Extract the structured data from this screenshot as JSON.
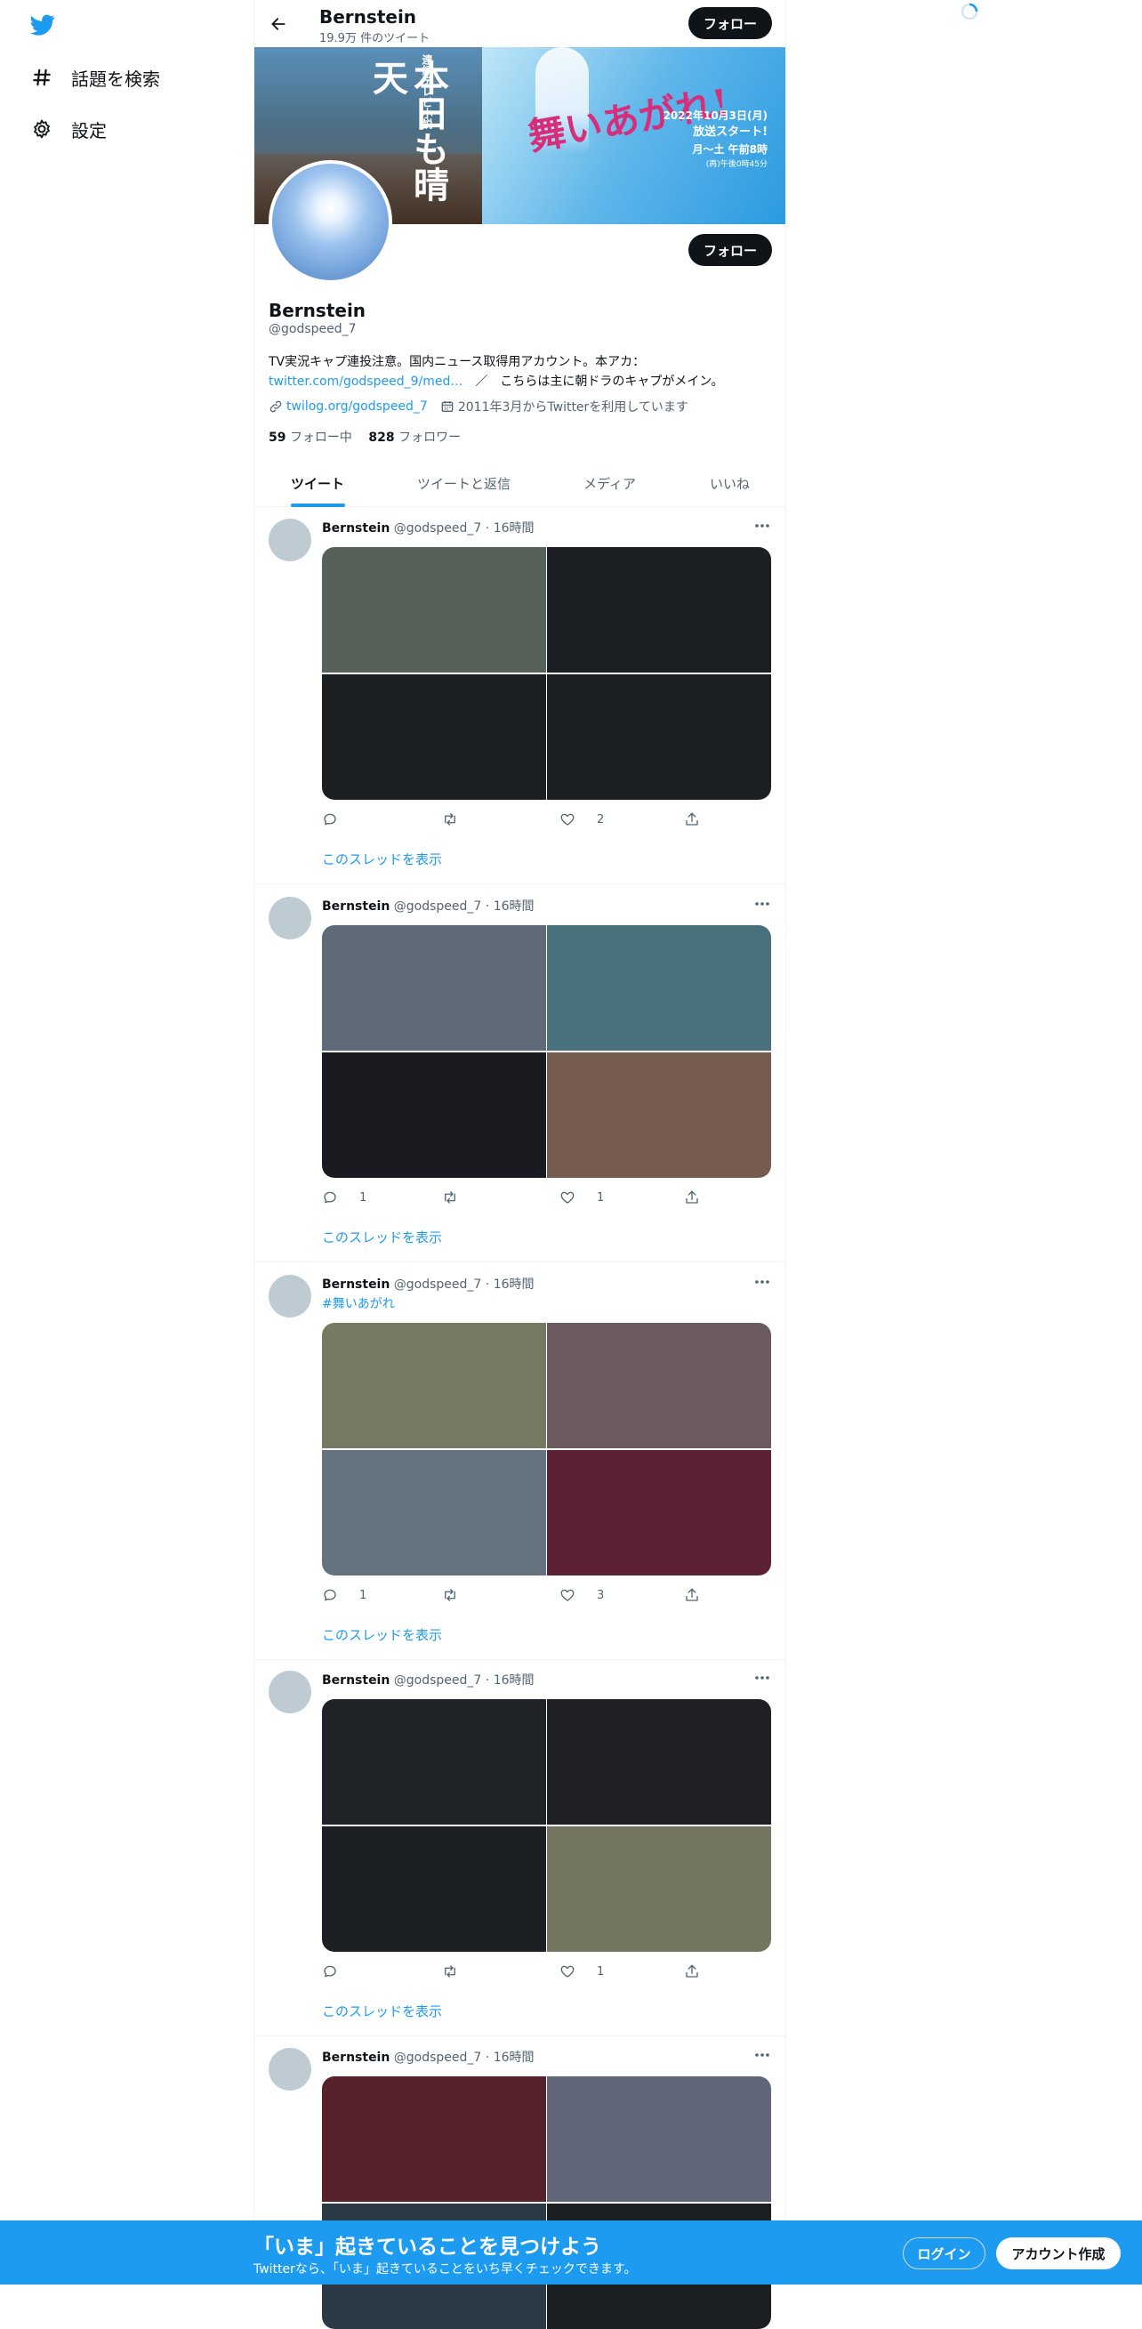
{
  "nav": {
    "items": [
      {
        "label": "話題を検索",
        "icon": "hashtag-icon"
      },
      {
        "label": "設定",
        "icon": "gear-icon"
      }
    ]
  },
  "header": {
    "title": "Bernstein",
    "subtitle": "19.9万 件のツイート",
    "follow_label": "フォロー"
  },
  "banner": {
    "left_small": "連続テレビ小説",
    "left_main": "本日も晴天",
    "right_title": "舞いあがれ!",
    "right_date": "2022年10月3日(月)",
    "right_start": "放送スタート!",
    "right_time": "月～土 午前8時",
    "right_rerun": "(再)午後0時45分"
  },
  "profile": {
    "name": "Bernstein",
    "handle": "@godspeed_7",
    "follow_label": "フォロー",
    "bio_line1": "TV実況キャプ連投注意。国内ニュース取得用アカウント。本アカ：",
    "bio_link": "twitter.com/godspeed_9/med…",
    "bio_line2_rest": "　／　こちらは主に朝ドラのキャプがメイン。",
    "website": "twilog.org/godspeed_7",
    "joined": "2011年3月からTwitterを利用しています",
    "following_count": "59",
    "following_label": "フォロー中",
    "followers_count": "828",
    "followers_label": "フォロワー"
  },
  "tabs": [
    "ツイート",
    "ツイートと返信",
    "メディア",
    "いいね"
  ],
  "tweets": [
    {
      "name": "Bernstein",
      "handle": "@godspeed_7",
      "time": "16時間",
      "hashtag": "",
      "colors": [
        "#566259",
        "#1b1e23",
        "#1c1f22",
        "#1c1f22"
      ],
      "replies": "",
      "retweets": "",
      "likes": "2",
      "thread": "このスレッドを表示"
    },
    {
      "name": "Bernstein",
      "handle": "@godspeed_7",
      "time": "16時間",
      "hashtag": "",
      "colors": [
        "#5f6a78",
        "#49717c",
        "#191b21",
        "#765b4f"
      ],
      "replies": "1",
      "retweets": "",
      "likes": "1",
      "thread": "このスレッドを表示"
    },
    {
      "name": "Bernstein",
      "handle": "@godspeed_7",
      "time": "16時間",
      "hashtag": "#舞いあがれ",
      "colors": [
        "#767a63",
        "#6b5a5e",
        "#657381",
        "#5c2132"
      ],
      "replies": "1",
      "retweets": "",
      "likes": "3",
      "thread": "このスレッドを表示"
    },
    {
      "name": "Bernstein",
      "handle": "@godspeed_7",
      "time": "16時間",
      "hashtag": "",
      "colors": [
        "#1f2226",
        "#1e2024",
        "#1c2024",
        "#747662"
      ],
      "replies": "",
      "retweets": "",
      "likes": "1",
      "thread": "このスレッドを表示"
    },
    {
      "name": "Bernstein",
      "handle": "@godspeed_7",
      "time": "16時間",
      "hashtag": "",
      "colors": [
        "#55212b",
        "#5f6778",
        "#2b3a44",
        "#1c1f22"
      ],
      "replies": "",
      "retweets": "",
      "likes": "",
      "thread": ""
    }
  ],
  "bottom_bar": {
    "title": "「いま」起きていることを見つけよう",
    "subtitle": "Twitterなら、「いま」起きていることをいち早くチェックできます。",
    "login_label": "ログイン",
    "signup_label": "アカウント作成"
  },
  "accent_color": "#1d9bf0"
}
